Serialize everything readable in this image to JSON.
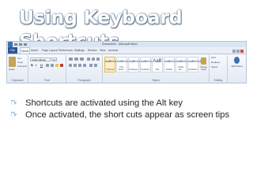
{
  "slide": {
    "title": "Using Keyboard Shortcuts",
    "bullets": [
      "Shortcuts are activated using the Alt key",
      "Once activated, the short cuts appear as screen tips"
    ]
  },
  "word": {
    "window_title": "Document1 - Microsoft Word",
    "tabs": [
      "File",
      "Home",
      "Insert",
      "Page Layout",
      "References",
      "Mailings",
      "Review",
      "View",
      "Acrobat"
    ],
    "active_tab": "Home",
    "font_name": "Calibri (Body)",
    "font_size": "11",
    "format_buttons": [
      "B",
      "I",
      "U"
    ],
    "groups": [
      "Clipboard",
      "Font",
      "Paragraph",
      "Styles",
      "Editing"
    ],
    "clipboard_items": [
      "Paste",
      "Cut",
      "Copy",
      "Format Painter"
    ],
    "styles": [
      {
        "preview": "AaBbCcDc",
        "name": "¶ Normal"
      },
      {
        "preview": "AaBbCcDc",
        "name": "¶ No Spaci..."
      },
      {
        "preview": "AaBbCc",
        "name": "Heading 1"
      },
      {
        "preview": "AaBbCc",
        "name": "Heading 2"
      },
      {
        "preview": "AaB",
        "name": "Title"
      },
      {
        "preview": "AaBbCc.",
        "name": "Subtitle"
      },
      {
        "preview": "AaBbCcDc",
        "name": "Subtle Em..."
      },
      {
        "preview": "AaBbCcDc",
        "name": "Emphasis"
      }
    ],
    "change_styles": "Change Styles",
    "editing_items": [
      "Find",
      "Replace",
      "Select"
    ],
    "extra_button": "Edit Phrases"
  },
  "colors": {
    "title_text": "#ffffff",
    "bullet_icon": "#8db3d8",
    "file_tab": "#2a5699",
    "body_text": "#262626"
  }
}
